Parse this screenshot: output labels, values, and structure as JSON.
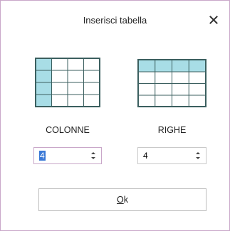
{
  "dialog": {
    "title": "Inserisci tabella",
    "close_label": "✕"
  },
  "columns": {
    "label": "COLONNE",
    "value": "4"
  },
  "rows": {
    "label": "RIGHE",
    "value": "4"
  },
  "ok_button": {
    "mnemonic": "O",
    "rest": "k"
  },
  "icons": {
    "close": "close-icon",
    "columns_grid": "table-columns-icon",
    "rows_grid": "table-rows-icon",
    "spinner": "spinner-arrows-icon"
  },
  "colors": {
    "grid_stroke": "#3b5f5f",
    "highlight": "#a8dde6",
    "focus_border": "#c9a7c9",
    "selection": "#3a78d6"
  }
}
